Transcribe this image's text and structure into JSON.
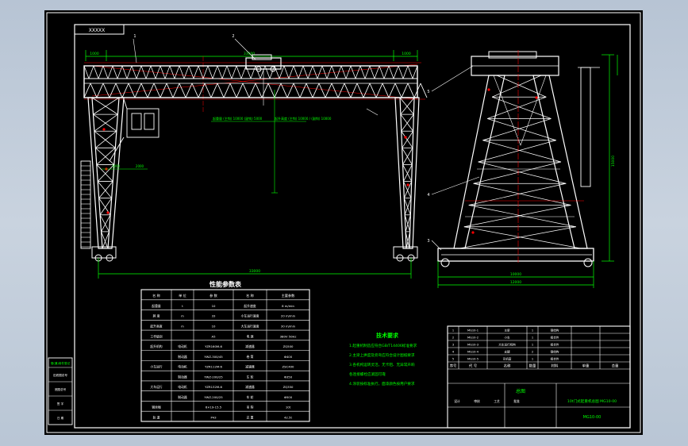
{
  "viewer": {
    "background_top": "#b7c4d4",
    "background_bottom": "#b9c6d5",
    "canvas_color": "#000000"
  },
  "drawing": {
    "title_tag": "XXXXX",
    "part_labels": [
      "1",
      "2",
      "3",
      "4",
      "5"
    ],
    "dimensions": {
      "top_span_left": "1000",
      "top_span_mid": "33000",
      "top_span_right": "1000",
      "bottom_span": "33000",
      "side_height": "15000",
      "side_base_inner": "10000",
      "side_base_outer": "12000",
      "hook_note_left": "起重量 (主钩) 10000 (副钩) 5000",
      "hook_note_right": "起升高度 (主钩) 10000 / (副钩) 10000",
      "left_small_1": "1000",
      "left_small_2": "2000"
    },
    "colors": {
      "structure": "#ffffff",
      "dimension": "#00ff00",
      "centerline": "#ff0000",
      "leader": "#ffffff",
      "table_lines": "#ffffff",
      "note_text": "#00ff00"
    }
  },
  "param_table": {
    "title": "性能参数表",
    "headers": [
      "名 称",
      "单 位",
      "参 数",
      "名 称",
      "主要参数"
    ],
    "rows": [
      [
        "起重量",
        "t",
        "10",
        "起升速度",
        "8 m/min"
      ],
      [
        "跨 度",
        "m",
        "33",
        "小车运行速度",
        "20 m/min"
      ],
      [
        "起升高度",
        "m",
        "10",
        "大车运行速度",
        "30 m/min"
      ],
      [
        "工作级别",
        "",
        "A5",
        "电 源",
        "380V 50Hz"
      ],
      [
        "起升机构",
        "电动机",
        "YZR160M-6",
        "减速器",
        "ZQ500"
      ],
      [
        "",
        "制动器",
        "YWZ-300/45",
        "卷 筒",
        "Φ400"
      ],
      [
        "小车运行",
        "电动机",
        "YZR112M-6",
        "减速器",
        "ZSC400"
      ],
      [
        "",
        "制动器",
        "YWZ-200/25",
        "车 轮",
        "Φ350"
      ],
      [
        "大车运行",
        "电动机",
        "YZR132M-6",
        "减速器",
        "ZQ350"
      ],
      [
        "",
        "制动器",
        "YWZ-200/25",
        "车 轮",
        "Φ500"
      ],
      [
        "钢丝绳",
        "",
        "6×19-15.5",
        "吊 钩",
        "10t"
      ],
      [
        "轨 道",
        "",
        "P43",
        "总 重",
        "42.5t"
      ]
    ]
  },
  "tech_notes": {
    "title": "技术要求",
    "items": [
      "1.起重机制造应符合GB/T14406标准要求",
      "2.主梁上拱度及旁弯应符合设计图纸要求",
      "3.各机构运转灵活，无卡阻、无异常声响",
      "  各连接螺栓应紧固可靠",
      "4.涂装按标准执行，面漆颜色按用户要求"
    ]
  },
  "left_block": {
    "header": "借(通)用件登记",
    "rows": [
      "旧底图总号",
      "底图总号",
      "签 字",
      "日 期"
    ]
  },
  "title_block": {
    "rows": [
      [
        "1",
        "MG10-1",
        "主梁",
        "1",
        "钢结构",
        "",
        ""
      ],
      [
        "2",
        "MG10-2",
        "小车",
        "1",
        "组合件",
        "",
        ""
      ],
      [
        "3",
        "MG10-3",
        "大车运行机构",
        "1",
        "组合件",
        "",
        ""
      ],
      [
        "4",
        "MG10-4",
        "支腿",
        "2",
        "钢结构",
        "",
        ""
      ],
      [
        "5",
        "MG10-5",
        "司机室",
        "1",
        "组合件",
        "",
        ""
      ]
    ],
    "header": [
      "序号",
      "代 号",
      "名称",
      "数量",
      "材料",
      "单重",
      "总重"
    ],
    "drawing_name": "总图",
    "product_name": "10t门式起重机总图 MG10-00",
    "drawing_no": "MG10-00",
    "sign_labels": [
      "设计",
      "审核",
      "工艺",
      "批准"
    ]
  }
}
